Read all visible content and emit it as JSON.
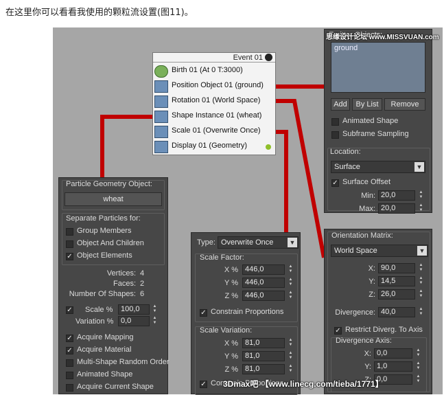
{
  "caption": "在这里你可以看看我使用的颗粒流设置(图11)。",
  "event": {
    "title": "Event 01",
    "operators": [
      {
        "label": "Birth 01 (At 0 T:3000)",
        "icon": "birth-icon"
      },
      {
        "label": "Position Object 01 (ground)",
        "icon": "position-object-icon"
      },
      {
        "label": "Rotation 01 (World Space)",
        "icon": "rotation-icon"
      },
      {
        "label": "Shape Instance 01 (wheat)",
        "icon": "shape-instance-icon"
      },
      {
        "label": "Scale 01 (Overwrite Once)",
        "icon": "scale-icon"
      },
      {
        "label": "Display 01 (Geometry)",
        "icon": "display-icon"
      }
    ]
  },
  "shape_panel": {
    "geom_title": "Particle Geometry Object:",
    "geom_value": "wheat",
    "sep_title": "Separate Particles for:",
    "sep_options": [
      {
        "label": "Group Members",
        "checked": false
      },
      {
        "label": "Object And Children",
        "checked": false
      },
      {
        "label": "Object Elements",
        "checked": true
      }
    ],
    "vertices_label": "Vertices:",
    "vertices_value": "4",
    "faces_label": "Faces:",
    "faces_value": "2",
    "shapes_label": "Number Of Shapes:",
    "shapes_value": "6",
    "scale_label": "Scale %",
    "scale_value": "100,0",
    "variation_label": "Variation %",
    "variation_value": "0,0",
    "options": [
      {
        "label": "Acquire Mapping",
        "checked": true
      },
      {
        "label": "Acquire Material",
        "checked": true
      },
      {
        "label": "Multi-Shape Random Order",
        "checked": false
      },
      {
        "label": "Animated Shape",
        "checked": false
      },
      {
        "label": "Acquire Current Shape",
        "checked": false
      }
    ]
  },
  "scale_panel": {
    "type_label": "Type:",
    "type_value": "Overwrite Once",
    "factor_title": "Scale Factor:",
    "factor": [
      {
        "axis": "X %",
        "value": "446,0"
      },
      {
        "axis": "Y %",
        "value": "446,0"
      },
      {
        "axis": "Z %",
        "value": "446,0"
      }
    ],
    "constrain_label": "Constrain Proportions",
    "variation_title": "Scale Variation:",
    "variation": [
      {
        "axis": "X %",
        "value": "81,0"
      },
      {
        "axis": "Y %",
        "value": "81,0"
      },
      {
        "axis": "Z %",
        "value": "81,0"
      }
    ],
    "constrain2_label": "Constrain Proportions"
  },
  "position_panel": {
    "title": "Emitter Objects:",
    "list_items": [
      "ground"
    ],
    "add_label": "Add",
    "bylist_label": "By List",
    "remove_label": "Remove",
    "animated_label": "Animated Shape",
    "subframe_label": "Subframe Sampling",
    "location_title": "Location:",
    "location_value": "Surface",
    "offset_label": "Surface Offset",
    "min_label": "Min:",
    "min_value": "20,0",
    "max_label": "Max:",
    "max_value": "20,0"
  },
  "rotation_panel": {
    "title": "Orientation Matrix:",
    "matrix_value": "World Space",
    "x_label": "X:",
    "x_value": "90,0",
    "y_label": "Y:",
    "y_value": "14,5",
    "z_label": "Z:",
    "z_value": "26,0",
    "div_label": "Divergence:",
    "div_value": "40,0",
    "restrict_label": "Restrict Diverg. To Axis",
    "axis_title": "Divergence Axis:",
    "ax_x_label": "X:",
    "ax_x_value": "0,0",
    "ax_y_label": "Y:",
    "ax_y_value": "1,0",
    "ax_z_label": "Z:",
    "ax_z_value": "0,0"
  },
  "watermark_left": "思缘设计论坛 www.MISSVUAN.com",
  "watermark_bottom": "3Dmax吧 【www.lin​ecg.com/tieba/1771】",
  "colors": {
    "connector": "#c00000",
    "panel": "#474747",
    "canvas": "#a6a6a6"
  }
}
